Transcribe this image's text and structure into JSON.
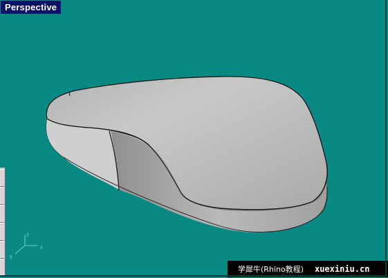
{
  "viewport": {
    "title": "Perspective",
    "background_color": "#098984",
    "title_bar_color": "#0c1268",
    "object": "mouse-shell-surface",
    "axis_labels": {
      "x": "x",
      "y": "y",
      "z": "z"
    }
  },
  "watermark": {
    "chinese": "学犀牛(Rhino教程)",
    "site": "xuexiniu.cn"
  },
  "side_toolbar": {
    "buttons": 6
  }
}
